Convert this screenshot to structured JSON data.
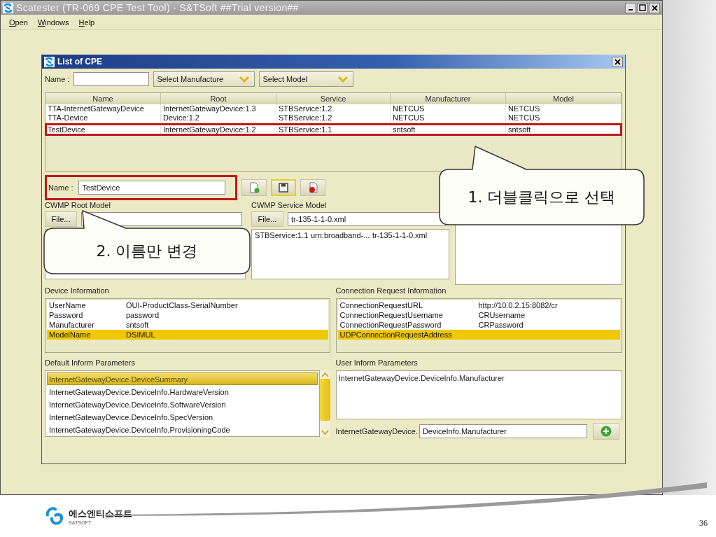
{
  "window": {
    "title": "Scatester (TR-069 CPE Test Tool) - S&TSoft ##Trial version##",
    "menu": [
      "Open",
      "Windows",
      "Help"
    ]
  },
  "dialog": {
    "title": "List of CPE",
    "filter": {
      "name_label": "Name :",
      "manufacturer": "Select Manufacture",
      "model": "Select Model"
    },
    "table": {
      "columns": [
        "Name",
        "Root",
        "Service",
        "Manufacturer",
        "Model"
      ],
      "rows": [
        {
          "cells": [
            "TTA-InternetGatewayDevice",
            "InternetGatewayDevice:1.3",
            "STBService:1.2",
            "NETCUS",
            "NETCUS"
          ],
          "highlighted": false
        },
        {
          "cells": [
            "TTA-Device",
            "Device:1.2",
            "STBService:1.2",
            "NETCUS",
            "NETCUS"
          ],
          "highlighted": false
        },
        {
          "cells": [
            "TestDevice",
            "InternetGatewayDevice:1.2",
            "STBService:1.1",
            "sntsoft",
            "sntsoft"
          ],
          "highlighted": true
        }
      ]
    },
    "edit": {
      "label": "Name :",
      "value": "TestDevice",
      "highlighted": true
    },
    "root_model": {
      "title": "CWMP Root Model",
      "file_button": "File..."
    },
    "service_model": {
      "title": "CWMP Service Model",
      "file_button": "File...",
      "file": "tr-135-1-1-0.xml",
      "rows": [
        [
          "STBService:1.1",
          "urn:broadband-...",
          "tr-135-1-1-0.xml"
        ]
      ]
    },
    "device_info": {
      "title": "Device Information",
      "rows": [
        {
          "cells": [
            "UserName",
            "OUI-ProductClass-SerialNumber"
          ],
          "selected": false
        },
        {
          "cells": [
            "Password",
            "password"
          ],
          "selected": false
        },
        {
          "cells": [
            "Manufacturer",
            "sntsoft"
          ],
          "selected": false
        },
        {
          "cells": [
            "ModelName",
            "DSIMUL"
          ],
          "selected": true
        }
      ]
    },
    "connection_info": {
      "title": "Connection Request Information",
      "rows": [
        {
          "cells": [
            "ConnectionRequestURL",
            "http://10.0.2.15:8082/cr"
          ],
          "selected": false
        },
        {
          "cells": [
            "ConnectionRequestUsername",
            "CRUsername"
          ],
          "selected": false
        },
        {
          "cells": [
            "ConnectionRequestPassword",
            "CRPassword"
          ],
          "selected": false
        },
        {
          "cells": [
            "UDPConnectionRequestAddress"
          ],
          "selected": true
        }
      ]
    },
    "default_inform": {
      "title": "Default Inform Parameters",
      "items": [
        {
          "label": "InternetGatewayDevice.DeviceSummary",
          "selected": true
        },
        {
          "label": "InternetGatewayDevice.DeviceInfo.HardwareVersion",
          "selected": false
        },
        {
          "label": "InternetGatewayDevice.DeviceInfo.SoftwareVersion",
          "selected": false
        },
        {
          "label": "InternetGatewayDevice.DeviceInfo.SpecVersion",
          "selected": false
        },
        {
          "label": "InternetGatewayDevice.DeviceInfo.ProvisioningCode",
          "selected": false
        }
      ]
    },
    "user_inform": {
      "title": "User Inform Parameters",
      "items": [
        "InternetGatewayDevice.DeviceInfo.Manufacturer"
      ],
      "prefix": "InternetGatewayDevice.",
      "value": "DeviceInfo.Manufacturer"
    }
  },
  "callouts": [
    {
      "text": "1. 더블클릭으로 선택"
    },
    {
      "text": "2. 이름만 변경"
    }
  ],
  "footer": {
    "company": "에스엔티소프트",
    "company_en": "S&TSOFT",
    "page": "36"
  }
}
